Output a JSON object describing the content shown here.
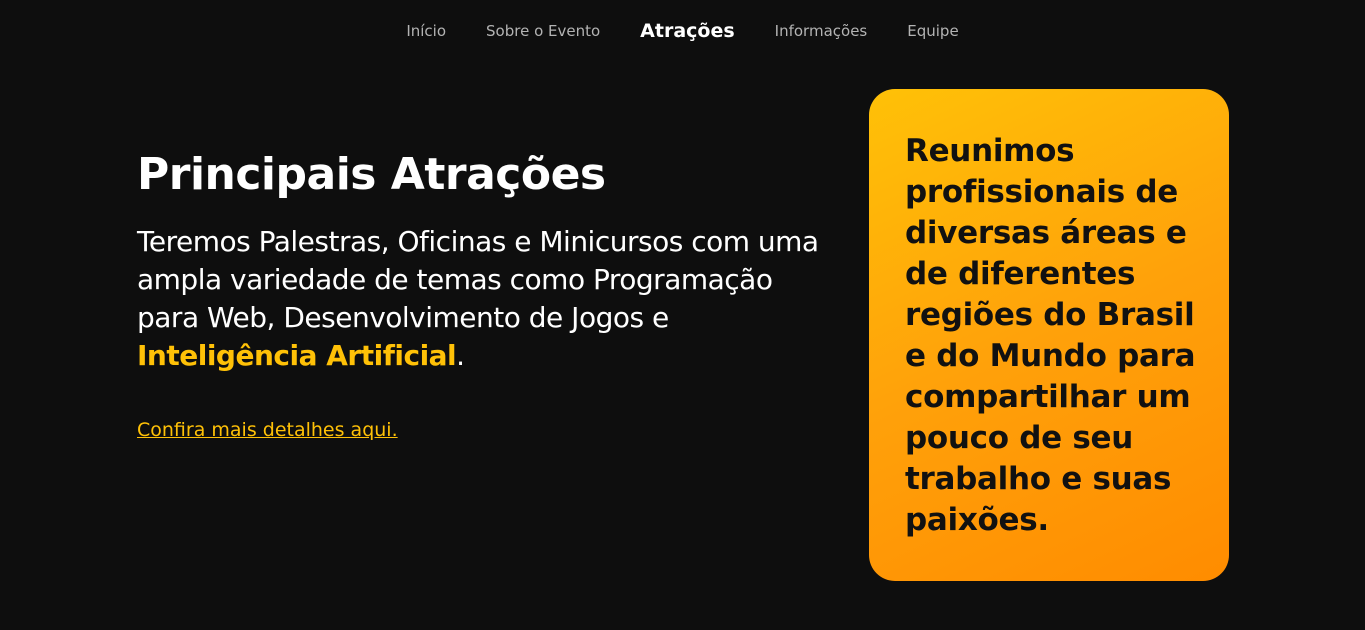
{
  "nav": {
    "items": [
      {
        "label": "Início",
        "active": false
      },
      {
        "label": "Sobre o Evento",
        "active": false
      },
      {
        "label": "Atrações",
        "active": true
      },
      {
        "label": "Informações",
        "active": false
      },
      {
        "label": "Equipe",
        "active": false
      }
    ]
  },
  "hero": {
    "title": "Principais Atrações",
    "description_before": "Teremos Palestras, Oficinas e Minicursos com uma ampla variedade de temas como Programação para Web, Desenvolvimento de Jogos e ",
    "description_highlight": "Inteligência Artificial",
    "description_after": ".",
    "link_label": "Confira mais detalhes aqui."
  },
  "card": {
    "text": "Reunimos profissionais de diversas áreas e de diferentes regiões do Brasil e do Mundo para compartilhar um pouco de seu trabalho e suas paixões."
  },
  "colors": {
    "background": "#0e0e0e",
    "accent": "#ffc107",
    "card_gradient_start": "#ffc107",
    "card_gradient_end": "#ff8c00",
    "card_text": "#111111"
  }
}
